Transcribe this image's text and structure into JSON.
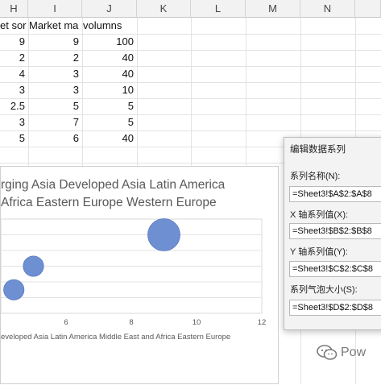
{
  "columns": [
    "H",
    "I",
    "J",
    "K",
    "L",
    "M",
    "N"
  ],
  "header_row": {
    "h": "et sor",
    "i": "Market ma",
    "j": "volumns"
  },
  "rows": [
    {
      "h": "9",
      "i": "9",
      "j": "100"
    },
    {
      "h": "2",
      "i": "2",
      "j": "40"
    },
    {
      "h": "4",
      "i": "3",
      "j": "40"
    },
    {
      "h": "3",
      "i": "3",
      "j": "10"
    },
    {
      "h": "2.5",
      "i": "5",
      "j": "5"
    },
    {
      "h": "3",
      "i": "7",
      "j": "5"
    },
    {
      "h": "5",
      "i": "6",
      "j": "40"
    }
  ],
  "chart_data": {
    "type": "scatter",
    "title_line1": "rging Asia Developed Asia Latin America",
    "title_line2": "Africa Eastern Europe Western Europe",
    "x_tick_labels": [
      "6",
      "8",
      "10",
      "12"
    ],
    "xlim": [
      4,
      12
    ],
    "legend_text": "eveloped Asia Latin America Middle East and Africa Eastern Europe",
    "bubbles": [
      {
        "x": 9,
        "y": 9,
        "size": 100
      },
      {
        "x": 5,
        "y": 7,
        "size": 40
      },
      {
        "x": 4.4,
        "y": 5.5,
        "size": 40
      }
    ],
    "bubble_color": "#6f8fd3"
  },
  "dialog": {
    "title": "编辑数据系列",
    "series_name_label": "系列名称(N):",
    "series_name_value": "=Sheet3!$A$2:$A$8",
    "x_values_label": "X 轴系列值(X):",
    "x_values_value": "=Sheet3!$B$2:$B$8",
    "y_values_label": "Y 轴系列值(Y):",
    "y_values_value": "=Sheet3!$C$2:$C$8",
    "bubble_size_label": "系列气泡大小(S):",
    "bubble_size_value": "=Sheet3!$D$2:$D$8"
  },
  "watermark": {
    "text": "Pow"
  }
}
